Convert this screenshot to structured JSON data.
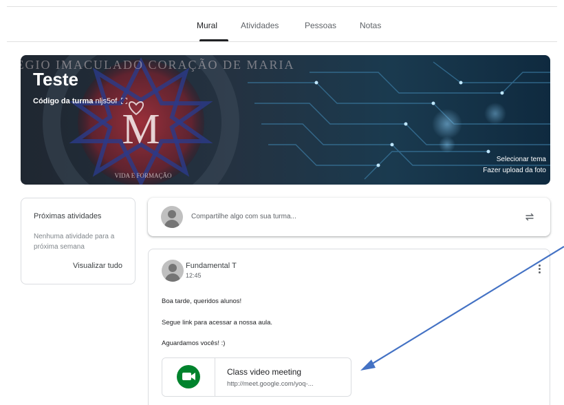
{
  "nav": {
    "tabs": [
      {
        "label": "Mural",
        "active": true
      },
      {
        "label": "Atividades",
        "active": false
      },
      {
        "label": "Pessoas",
        "active": false
      },
      {
        "label": "Notas",
        "active": false
      }
    ]
  },
  "banner": {
    "title": "Teste",
    "code_label": "Código da turma",
    "code_value": "nljs5of",
    "select_theme": "Selecionar tema",
    "upload_photo": "Fazer upload da foto",
    "emblem": {
      "ring_text": "COLÉGIO IMACULADO CORAÇÃO DE MARIA",
      "bottom_text": "VIDA E FORMAÇÃO",
      "letter": "M"
    }
  },
  "upcoming": {
    "title": "Próximas atividades",
    "empty_text": "Nenhuma atividade para a próxima semana",
    "view_all": "Visualizar tudo"
  },
  "share": {
    "placeholder": "Compartilhe algo com sua turma..."
  },
  "post": {
    "author": "Fundamental T",
    "time": "12:45",
    "lines": [
      "Boa tarde, queridos alunos!",
      "Segue link para acessar a nossa aula.",
      "Aguardamos vocês! :)"
    ],
    "attachment": {
      "title": "Class video meeting",
      "url": "http://meet.google.com/yoq-..."
    }
  },
  "colors": {
    "annotation_arrow": "#4472c4",
    "meet_green": "#00832d",
    "tab_active": "#202124"
  },
  "icons": [
    "fullscreen-icon",
    "repost-icon",
    "more-vert-icon",
    "google-meet-icon",
    "avatar-icon"
  ]
}
